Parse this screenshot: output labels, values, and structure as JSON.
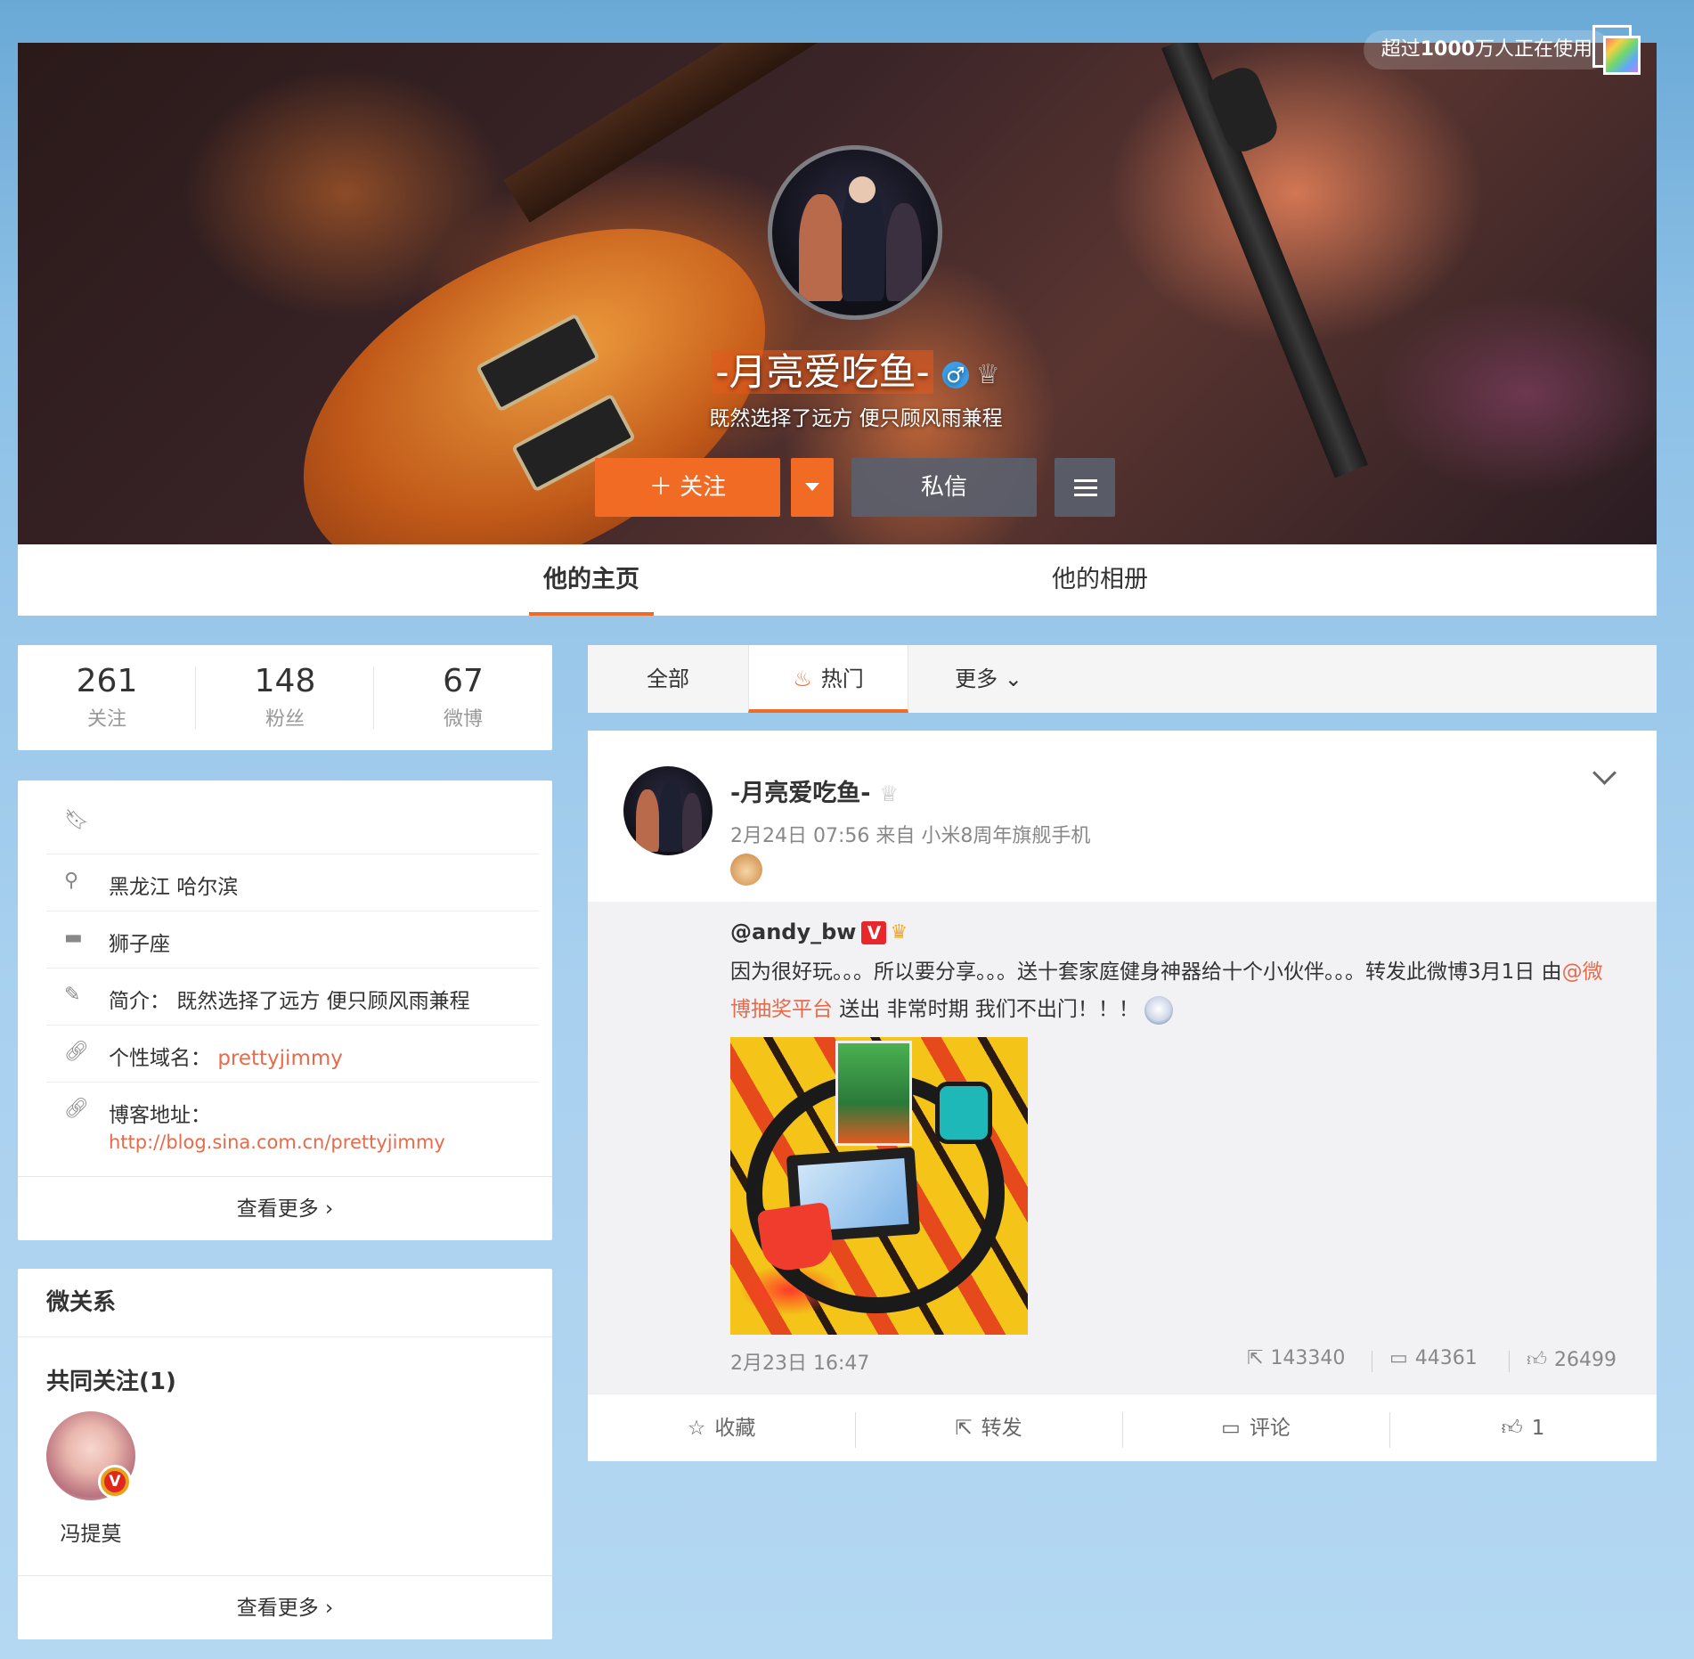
{
  "header": {
    "users_text_prefix": "超过",
    "users_count": "1000",
    "users_text_suffix": "万人正在使用"
  },
  "profile": {
    "name": "-月亮爱吃鱼-",
    "gender_icon": "male-icon",
    "bio": "既然选择了远方 便只顾风雨兼程",
    "follow_label": "关注",
    "message_label": "私信"
  },
  "tabs": [
    {
      "label": "他的主页",
      "active": true
    },
    {
      "label": "他的相册",
      "active": false
    }
  ],
  "stats": [
    {
      "value": "261",
      "label": "关注"
    },
    {
      "value": "148",
      "label": "粉丝"
    },
    {
      "value": "67",
      "label": "微博"
    }
  ],
  "info": {
    "location": "黑龙江 哈尔滨",
    "zodiac": "狮子座",
    "intro_label": "简介：",
    "intro_value": "既然选择了远方 便只顾风雨兼程",
    "domain_label": "个性域名：",
    "domain_value": "prettyjimmy",
    "blog_label": "博客地址：",
    "blog_value": "http://blog.sina.com.cn/prettyjimmy",
    "more_label": "查看更多"
  },
  "relations": {
    "title": "微关系",
    "mutual_title": "共同关注(1)",
    "mutual_name": "冯提莫",
    "more_label": "查看更多"
  },
  "feed_filter": {
    "all": "全部",
    "hot": "热门",
    "more": "更多"
  },
  "post": {
    "author": "-月亮爱吃鱼-",
    "meta": "2月24日 07:56 来自 小米8周年旗舰手机",
    "repost": {
      "author": "@andy_bw",
      "text_before": "因为很好玩。。。所以要分享。。。送十套家庭健身神器给十个小伙伴。。。转发此微博3月1日 由",
      "mention": "@微博抽奖平台",
      "text_after": " 送出 非常时期 我们不出门！！！",
      "time": "2月23日 16:47",
      "reposts": "143340",
      "comments": "44361",
      "likes": "26499"
    },
    "actions": {
      "favorite": "收藏",
      "repost": "转发",
      "comment": "评论",
      "like": "1"
    }
  },
  "colors": {
    "accent": "#f26b24",
    "link": "#e86a4a"
  }
}
